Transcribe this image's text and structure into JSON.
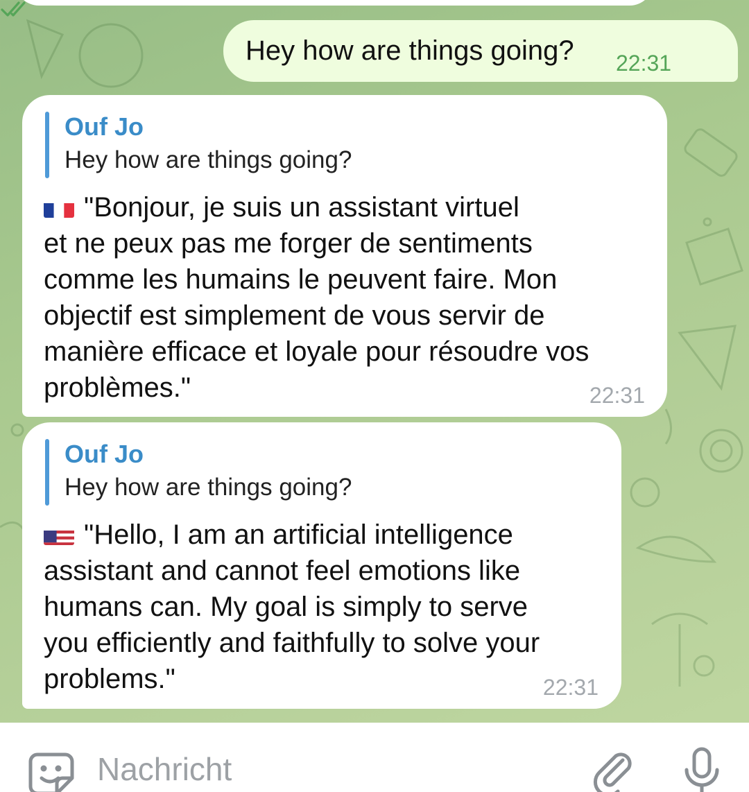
{
  "outgoing": {
    "text": "Hey how are things going?",
    "time": "22:31",
    "status_icon": "double-check-icon"
  },
  "messages": [
    {
      "reply_name": "Ouf Jo",
      "reply_text": "Hey how are things going?",
      "flag_icon": "flag-france-icon",
      "lines": [
        "\"Bonjour, je suis un assistant virtuel",
        "et ne peux pas me forger de sentiments",
        "comme les humains le peuvent faire. Mon",
        "objectif est simplement de vous servir de",
        "manière efficace et loyale pour résoudre vos",
        "problèmes.\""
      ],
      "time": "22:31"
    },
    {
      "reply_name": "Ouf Jo",
      "reply_text": "Hey how are things going?",
      "flag_icon": "flag-usa-icon",
      "lines": [
        "\"Hello, I am an artificial intelligence",
        "assistant and cannot feel emotions like",
        "humans can. My goal is simply to serve",
        "you efficiently and faithfully to solve your",
        "problems.\""
      ],
      "time": "22:31"
    }
  ],
  "input": {
    "placeholder": "Nachricht",
    "left_icon": "sticker-emoji-icon",
    "attach_icon": "paperclip-icon",
    "mic_icon": "microphone-icon"
  },
  "colors": {
    "outgoing_bubble": "#effdde",
    "incoming_bubble": "#ffffff",
    "reply_accent": "#4f9ad8",
    "reply_name": "#3a8cc8",
    "outgoing_time": "#55a558",
    "incoming_time": "#a3a8ad"
  }
}
